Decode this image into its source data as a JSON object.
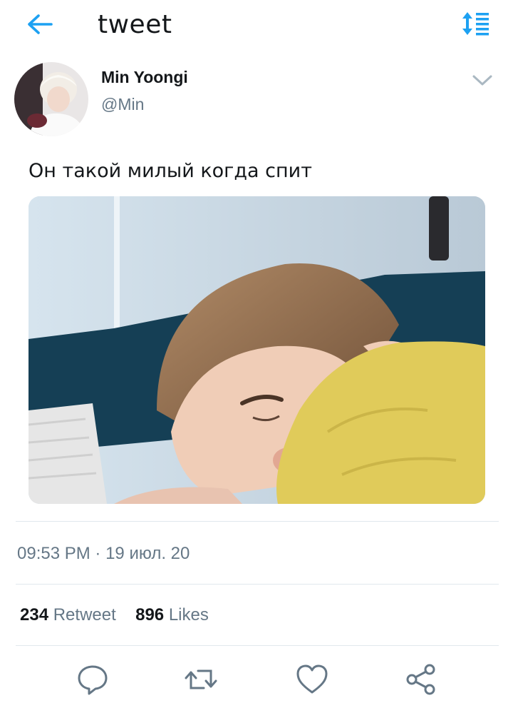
{
  "header": {
    "title": "tweet",
    "back_icon": "arrow-left-icon",
    "sort_icon": "sort-list-icon",
    "accent_color": "#1da1f2"
  },
  "tweet": {
    "author_name": "Min Yoongi",
    "author_handle": "@Min",
    "text": "Он такой милый когда спит",
    "time": "09:53 PM",
    "separator": "·",
    "date": "19 июл. 20",
    "retweet_count": "234",
    "retweet_label": "Retweet",
    "like_count": "896",
    "like_label": "Likes"
  },
  "actions": [
    {
      "icon": "reply-icon"
    },
    {
      "icon": "retweet-icon"
    },
    {
      "icon": "heart-icon"
    },
    {
      "icon": "share-icon"
    }
  ]
}
